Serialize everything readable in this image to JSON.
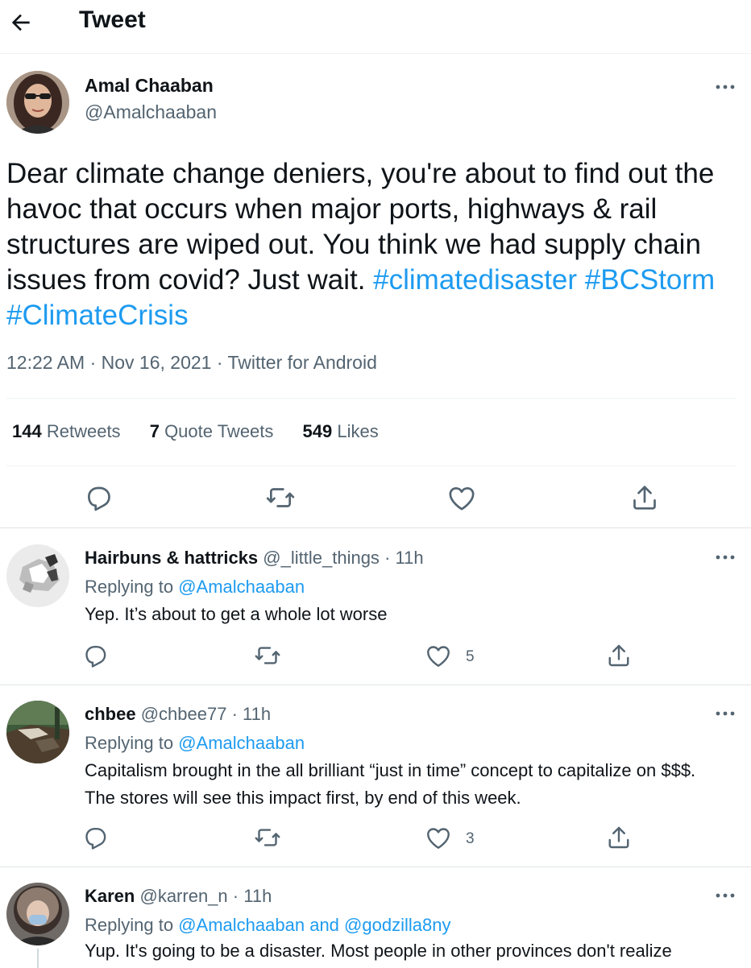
{
  "header": {
    "title": "Tweet"
  },
  "main_tweet": {
    "name": "Amal Chaaban",
    "handle": "@Amalchaaban",
    "text_plain": "Dear climate change deniers, you're about to find out the havoc that occurs when major ports, highways & rail structures are wiped out. You think we had supply chain issues from covid? Just wait. ",
    "hashtags": [
      "#climatedisaster",
      "#BCStorm",
      "#ClimateCrisis"
    ],
    "time": "12:22 AM",
    "date": "Nov 16, 2021",
    "source": "Twitter for Android",
    "dot": "·",
    "stats": {
      "retweets_count": "144",
      "retweets_label": "Retweets",
      "quotes_count": "7",
      "quotes_label": "Quote Tweets",
      "likes_count": "549",
      "likes_label": "Likes"
    },
    "actions": [
      "reply-icon",
      "retweet-icon",
      "like-icon",
      "share-icon"
    ]
  },
  "replies": [
    {
      "name": "Hairbuns & hattricks",
      "handle": "@_little_things",
      "time": "11h",
      "replying_label": "Replying to",
      "replying_to": "@Amalchaaban",
      "replying_and": "",
      "replying_to_2": "",
      "text": "Yep.  It’s about to get a whole lot worse",
      "likes": "5"
    },
    {
      "name": "chbee",
      "handle": "@chbee77",
      "time": "11h",
      "replying_label": "Replying to",
      "replying_to": "@Amalchaaban",
      "replying_and": "",
      "replying_to_2": "",
      "text": "Capitalism brought in the all brilliant “just in time” concept to capitalize on $$$. The stores will see this impact first, by end of this week.",
      "likes": "3"
    },
    {
      "name": "Karen",
      "handle": "@karren_n",
      "time": "11h",
      "replying_label": "Replying to",
      "replying_to": "@Amalchaaban",
      "replying_and": "and",
      "replying_to_2": "@godzilla8ny",
      "text": "Yup. It's going to be a disaster. Most people in other provinces don't realize",
      "likes": ""
    }
  ],
  "colors": {
    "link": "#1d9bf0",
    "muted": "#536471",
    "text": "#0f1419",
    "border": "#eff3f4"
  }
}
